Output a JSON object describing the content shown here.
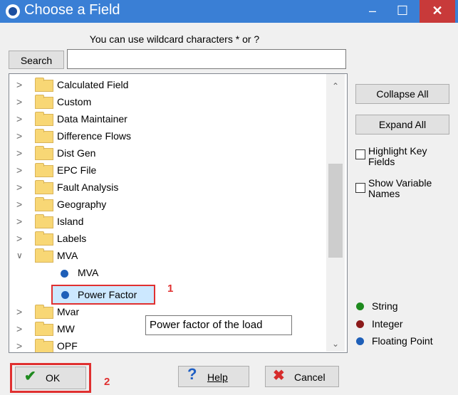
{
  "window": {
    "title": "Choose a Field",
    "minimize": "–",
    "maximize": "☐",
    "close": "✕"
  },
  "search": {
    "hint": "You can use wildcard characters * or ?",
    "button_label": "Search",
    "value": ""
  },
  "tree": {
    "folders_top": [
      "Calculated Field",
      "Custom",
      "Data Maintainer",
      "Difference Flows",
      "Dist Gen",
      "EPC File",
      "Fault Analysis",
      "Geography",
      "Island",
      "Labels",
      "MVA"
    ],
    "mva_children": [
      "MVA",
      "Power Factor"
    ],
    "folders_bottom": [
      "Mvar",
      "MW",
      "OPF"
    ],
    "selected": "Power Factor",
    "tooltip": "Power factor of the load"
  },
  "right_panel": {
    "collapse_all": "Collapse All",
    "expand_all": "Expand All",
    "highlight_key_fields": "Highlight Key Fields",
    "show_variable_names": "Show Variable Names",
    "legend": [
      {
        "label": "String",
        "color": "#1e8a1e"
      },
      {
        "label": "Integer",
        "color": "#8b1a1a"
      },
      {
        "label": "Floating Point",
        "color": "#1e5fb8"
      }
    ]
  },
  "buttons": {
    "ok": "OK",
    "help": "Help",
    "cancel": "Cancel"
  },
  "annotations": {
    "step1": "1",
    "step2": "2"
  }
}
